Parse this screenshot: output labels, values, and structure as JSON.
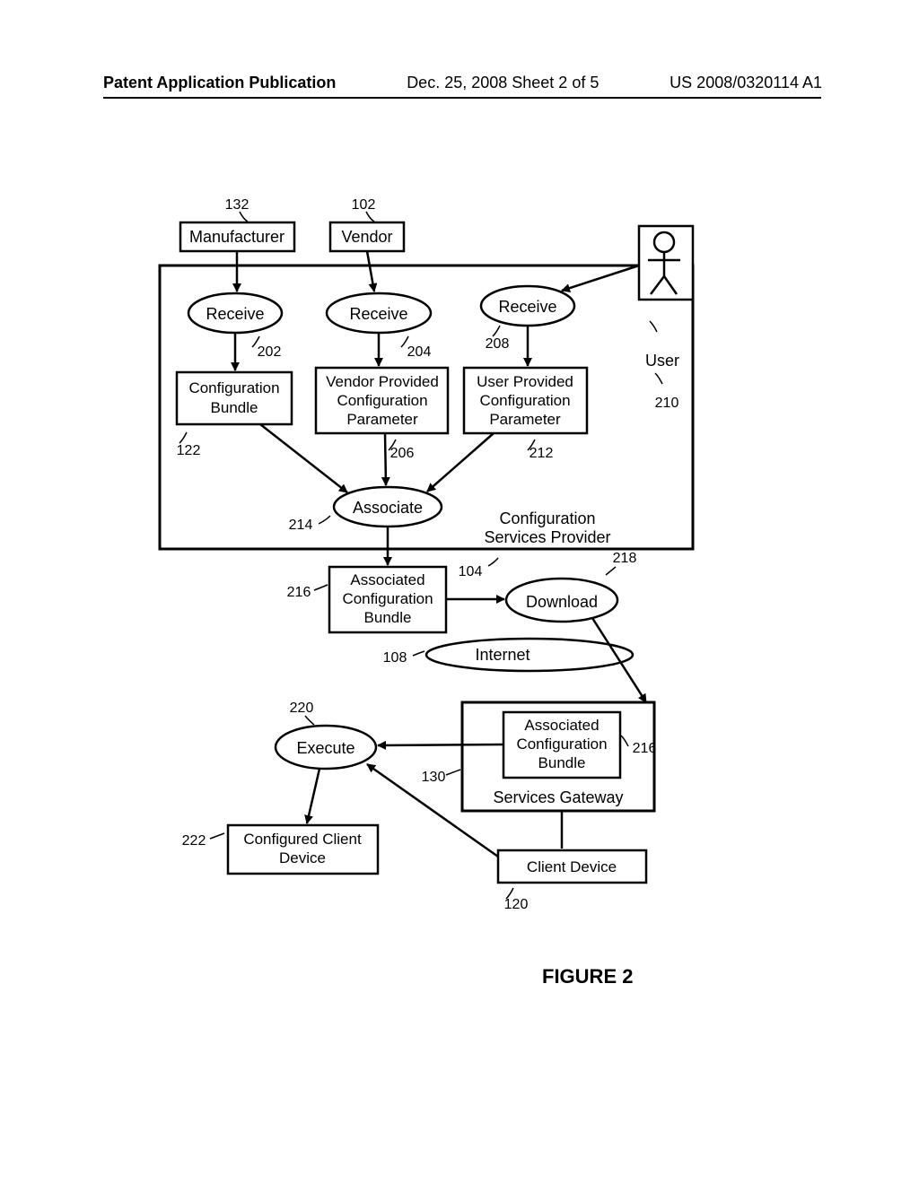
{
  "header": {
    "left": "Patent Application Publication",
    "mid": "Dec. 25, 2008  Sheet 2 of 5",
    "right": "US 2008/0320114 A1"
  },
  "figure_caption": "FIGURE 2",
  "nodes": {
    "manufacturer": "Manufacturer",
    "vendor": "Vendor",
    "receive1": "Receive",
    "receive2": "Receive",
    "receive3": "Receive",
    "config_bundle": "Configuration\nBundle",
    "vendor_param": "Vendor Provided\nConfiguration\nParameter",
    "user_param": "User Provided\nConfiguration\nParameter",
    "associate": "Associate",
    "assoc_bundle": "Associated\nConfiguration\nBundle",
    "download": "Download",
    "internet": "Internet",
    "execute": "Execute",
    "assoc_bundle2": "Associated\nConfiguration\nBundle",
    "configured_client": "Configured Client\nDevice",
    "client_device": "Client Device",
    "user_label": "User",
    "csp_label": "Configuration\nServices Provider",
    "gateway_label": "Services Gateway"
  },
  "refs": {
    "r132": "132",
    "r102": "102",
    "r202": "202",
    "r204": "204",
    "r208": "208",
    "r210": "210",
    "r122": "122",
    "r206": "206",
    "r212": "212",
    "r214": "214",
    "r104": "104",
    "r218": "218",
    "r216a": "216",
    "r108": "108",
    "r220": "220",
    "r216b": "216",
    "r130": "130",
    "r222": "222",
    "r120": "120"
  }
}
